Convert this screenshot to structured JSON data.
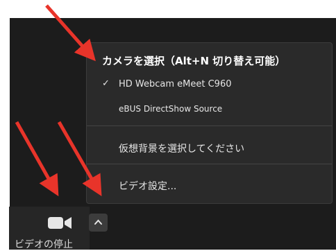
{
  "menu": {
    "heading": "カメラを選択（Alt+N 切り替え可能）",
    "items": [
      {
        "label": "HD Webcam eMeet C960",
        "checked": true
      },
      {
        "label": "eBUS DirectShow Source",
        "checked": false
      },
      {
        "label": "仮想背景を選択してください",
        "checked": false
      },
      {
        "label": "ビデオ設定...",
        "checked": false
      }
    ],
    "check_glyph": "✓"
  },
  "toolbar": {
    "video_button_label": "ビデオの停止",
    "video_icon": "video-camera-icon",
    "chevron_icon": "chevron-up-icon"
  },
  "annotations": {
    "arrow_color": "#e8342a",
    "arrow_count": 3
  },
  "colors": {
    "background": "#1c1c1c",
    "menu_bg": "#2a2a2a"
  }
}
